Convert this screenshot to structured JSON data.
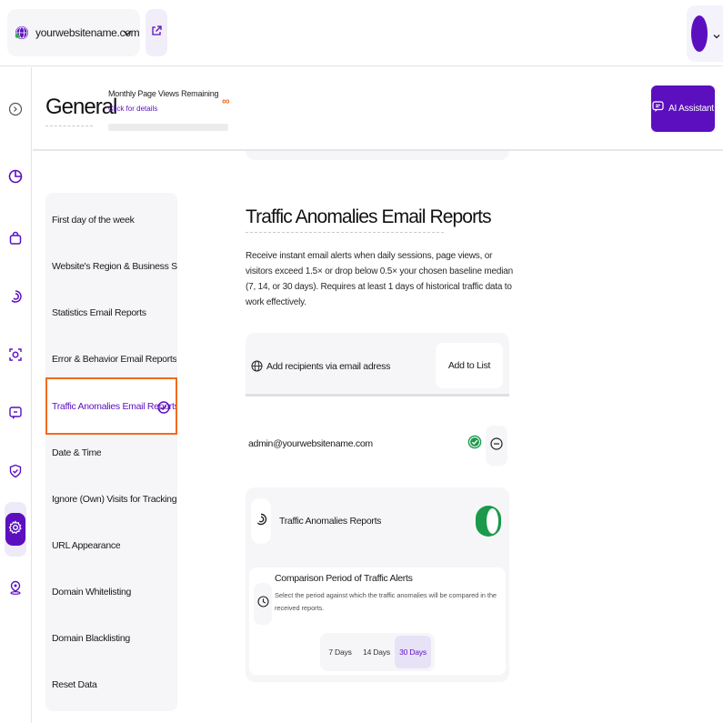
{
  "topbar": {
    "site_name": "yourwebsitename.com",
    "icons": {
      "site": "globe-icon",
      "dropdown": "chevron-down-icon",
      "external": "external-link-icon"
    }
  },
  "rail": {
    "items": [
      {
        "icon": "collapse-icon"
      },
      {
        "icon": "pie-chart-icon"
      },
      {
        "icon": "shopping-bag-icon"
      },
      {
        "icon": "traffic-icon"
      },
      {
        "icon": "target-icon"
      },
      {
        "icon": "feedback-icon"
      },
      {
        "icon": "shield-icon"
      },
      {
        "icon": "gear-icon",
        "active": true
      },
      {
        "icon": "location-icon"
      }
    ]
  },
  "header": {
    "title": "General",
    "page_views_label": "Monthly Page Views Remaining",
    "page_views_link": "Click for details",
    "page_views_value": "∞",
    "ai_button": "AI Assistant"
  },
  "settings_nav": {
    "items": [
      {
        "label": "First day of the week"
      },
      {
        "label": "Website's Region & Business Sector"
      },
      {
        "label": "Statistics Email Reports"
      },
      {
        "label": "Error & Behavior Email Reports"
      },
      {
        "label": "Traffic Anomalies Email Reports",
        "selected": true
      },
      {
        "label": "Date & Time"
      },
      {
        "label": "Ignore (Own) Visits for Tracking by..."
      },
      {
        "label": "URL Appearance"
      },
      {
        "label": "Domain Whitelisting"
      },
      {
        "label": "Domain Blacklisting"
      },
      {
        "label": "Reset Data"
      }
    ]
  },
  "main": {
    "title": "Traffic Anomalies Email Reports",
    "description": "Receive instant email alerts when daily sessions, page views, or visitors exceed 1.5× or drop below 0.5× your chosen baseline median (7, 14, or 30 days). Requires at least 1 days of historical traffic data to work effectively.",
    "recipients_label": "Add recipients via email adress",
    "add_button": "Add to List",
    "recipient_email": "admin@yourwebsitename.com",
    "report_label": "Traffic Anomalies Reports",
    "report_enabled": true,
    "period_title": "Comparison Period of Traffic Alerts",
    "period_desc": "Select the period against which the traffic anomalies will be compared in the received reports.",
    "period_options": [
      "7 Days",
      "14 Days",
      "30 Days"
    ],
    "period_selected": "30 Days"
  },
  "colors": {
    "brand": "#5b0fbf",
    "highlight": "#f26b1d",
    "success": "#1a9a4a"
  }
}
